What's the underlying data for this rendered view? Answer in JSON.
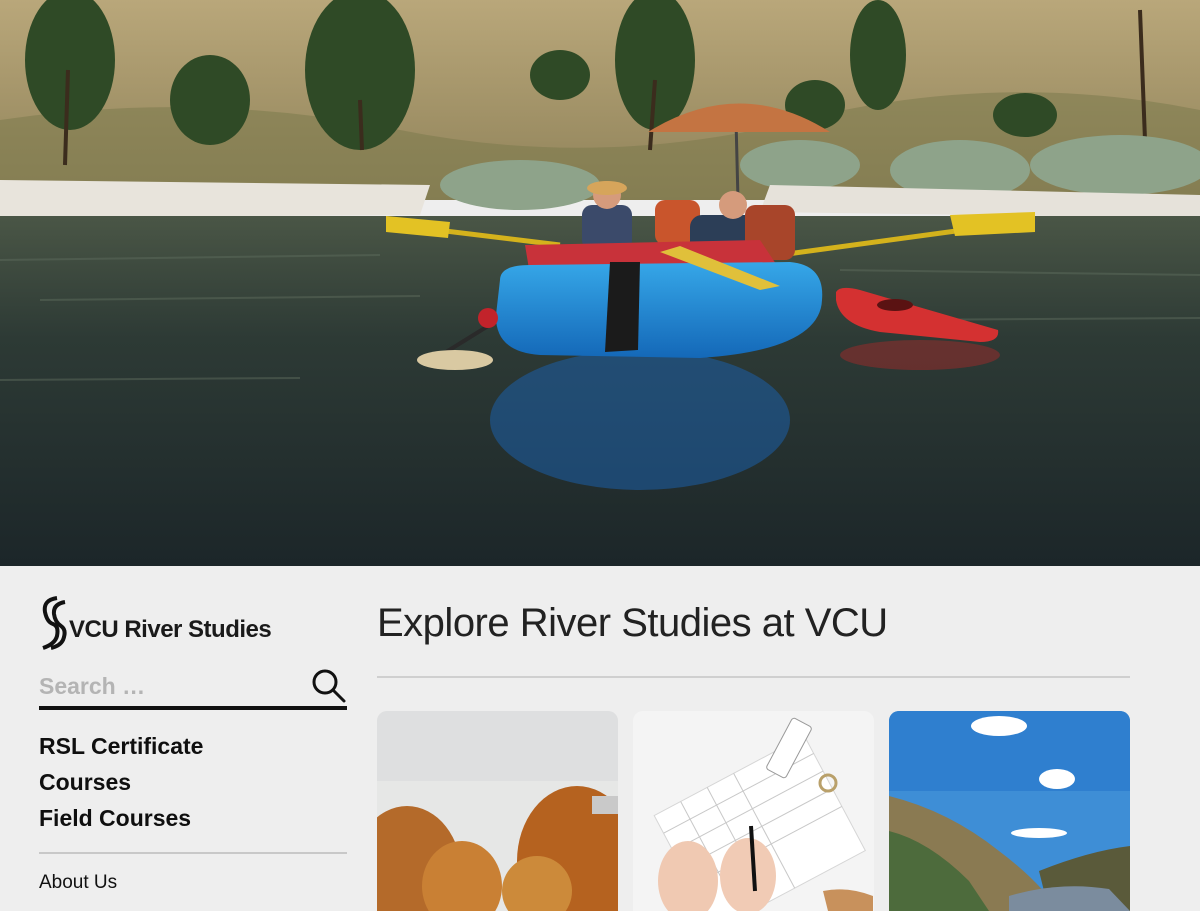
{
  "brand": {
    "name": "VCU River Studies"
  },
  "search": {
    "placeholder": "Search …",
    "value": ""
  },
  "nav": {
    "primary": [
      {
        "label": "RSL Certificate"
      },
      {
        "label": "Courses"
      },
      {
        "label": "Field Courses"
      }
    ],
    "secondary": [
      {
        "label": "About Us"
      }
    ]
  },
  "main": {
    "title": "Explore River Studies at VCU"
  },
  "icons": {
    "search": "search-icon",
    "logo": "river-s-logo-icon"
  },
  "colors": {
    "background": "#eeeeee",
    "text": "#222222",
    "divider": "#cfcfcf",
    "search_underline": "#111111"
  }
}
